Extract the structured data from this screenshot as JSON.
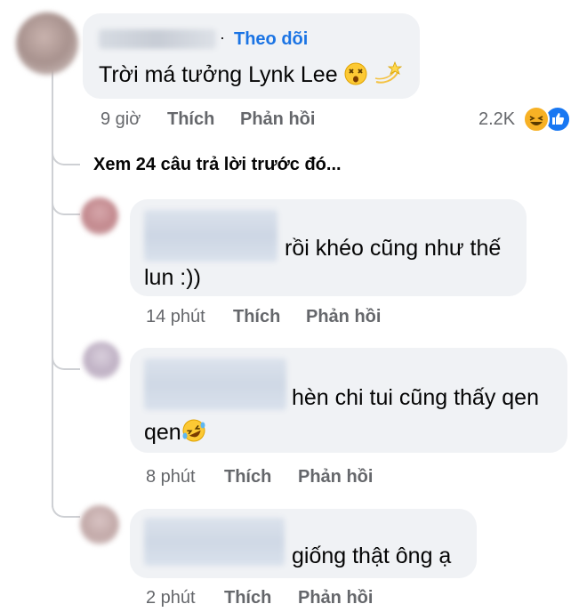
{
  "top_comment": {
    "follow_label": "Theo dõi",
    "text": "Trời má tưởng Lynk Lee",
    "emojis": [
      "dizzy-face-emoji",
      "dizzy-star-emoji"
    ],
    "time": "9 giờ",
    "like_label": "Thích",
    "reply_label": "Phản hồi",
    "reaction_count": "2.2K",
    "reactions": [
      "haha-reaction",
      "like-reaction"
    ]
  },
  "view_more": "Xem 24 câu trả lời trước đó...",
  "replies": [
    {
      "line1": "rồi khéo cũng như thế",
      "line2": "lun :))",
      "time": "14 phút",
      "like_label": "Thích",
      "reply_label": "Phản hồi"
    },
    {
      "line1": "hèn chi tui cũng thấy qen",
      "line2": "qen",
      "emoji": "rofl-emoji",
      "time": "8 phút",
      "like_label": "Thích",
      "reply_label": "Phản hồi"
    },
    {
      "line1": "giống thật ông ạ",
      "time": "2 phút",
      "like_label": "Thích",
      "reply_label": "Phản hồi"
    }
  ],
  "colors": {
    "bubble": "#f0f2f5",
    "link_blue": "#1b74e4",
    "meta_gray": "#65676b",
    "thread_line": "#ced0d4"
  }
}
